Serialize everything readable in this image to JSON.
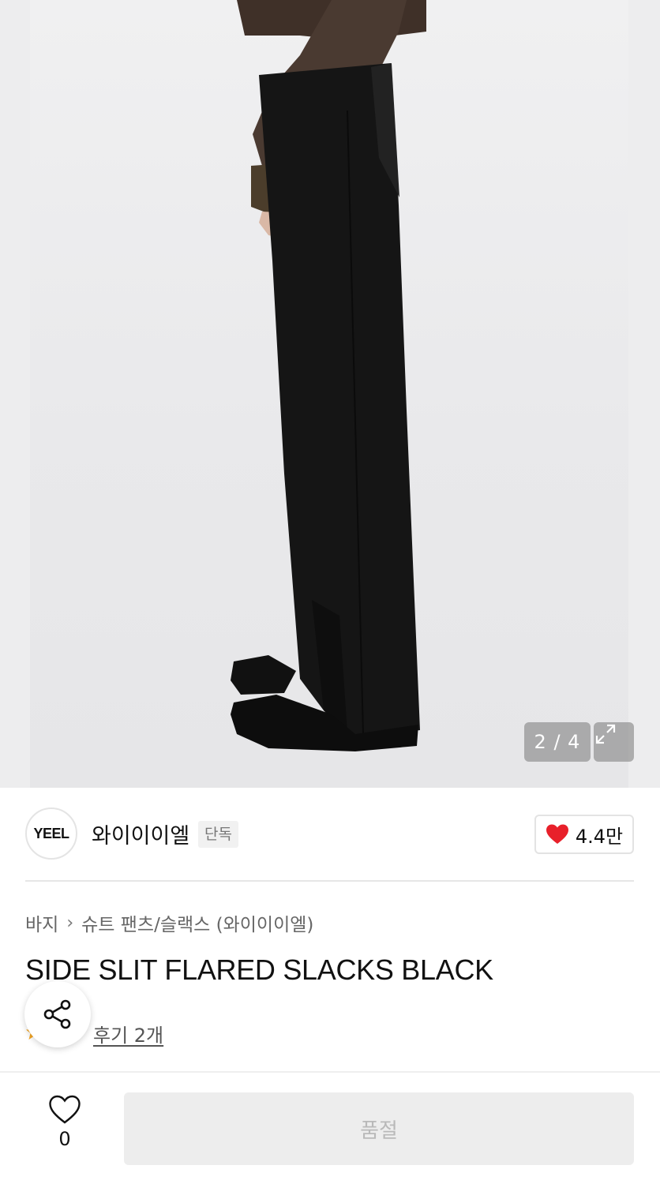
{
  "gallery": {
    "counter": "2 / 4",
    "image_alt": "product-photo-side-slit-flared-slacks",
    "expand_icon": "expand-icon"
  },
  "brand": {
    "logo_text": "YEEL",
    "name": "와이이이엘",
    "badge": "단독",
    "likes": "4.4만",
    "like_icon": "heart-filled-icon",
    "like_color": "#e8202a"
  },
  "breadcrumb": {
    "category": "바지",
    "subcategory": "슈트 팬츠/슬랙스 (와이이이엘)"
  },
  "product": {
    "title": "SIDE SLIT FLARED SLACKS BLACK",
    "review_link": "후기 2개",
    "star_color": "#f5a623"
  },
  "share": {
    "icon": "share-icon"
  },
  "bottom": {
    "wish_count": "0",
    "wish_icon": "heart-outline-icon",
    "buy_label": "품절"
  }
}
